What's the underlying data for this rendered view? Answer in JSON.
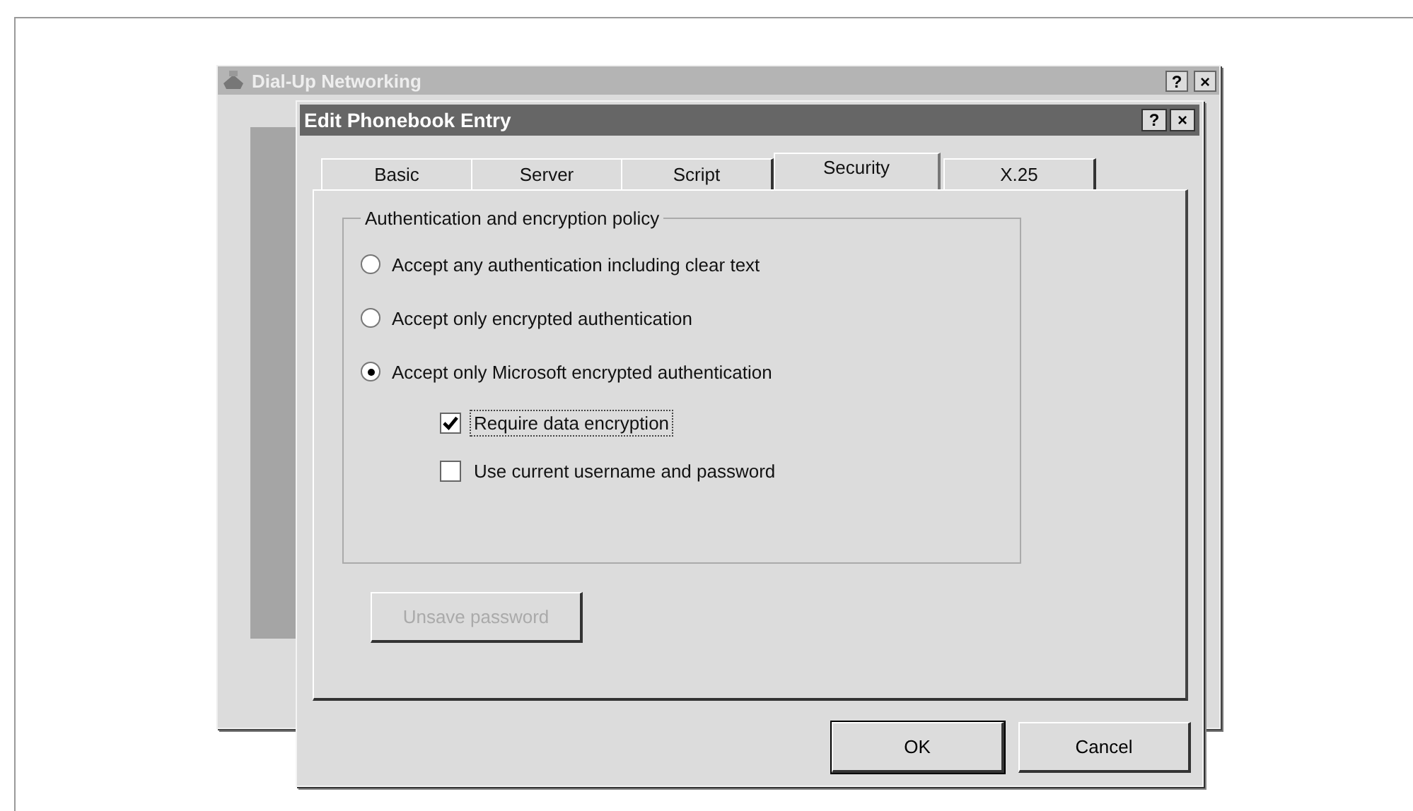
{
  "back_window": {
    "title": "Dial-Up Networking",
    "help_button": "?",
    "close_button": "×"
  },
  "dialog": {
    "title": "Edit Phonebook Entry",
    "help_button": "?",
    "close_button": "×"
  },
  "tabs": [
    {
      "label": "Basic",
      "selected": false
    },
    {
      "label": "Server",
      "selected": false
    },
    {
      "label": "Script",
      "selected": false
    },
    {
      "label": "Security",
      "selected": true
    },
    {
      "label": "X.25",
      "selected": false
    }
  ],
  "policy_group": {
    "label": "Authentication and encryption policy",
    "options": [
      {
        "label": "Accept any authentication including clear text",
        "selected": false
      },
      {
        "label": "Accept only encrypted authentication",
        "selected": false
      },
      {
        "label": "Accept only Microsoft encrypted authentication",
        "selected": true
      }
    ],
    "checkboxes": [
      {
        "label": "Require data encryption",
        "checked": true,
        "focused": true
      },
      {
        "label": "Use current username and password",
        "checked": false,
        "focused": false
      }
    ]
  },
  "unsave_button": {
    "label": "Unsave password",
    "disabled": true
  },
  "buttons": [
    "OK",
    "Cancel"
  ]
}
